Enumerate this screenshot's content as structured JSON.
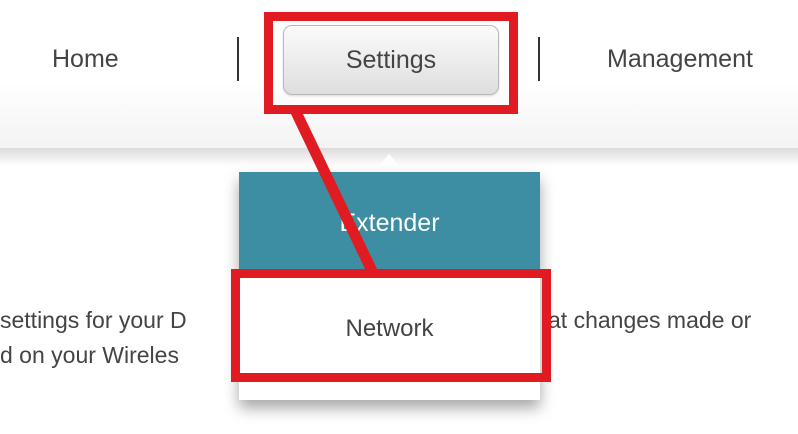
{
  "nav": {
    "home_label": "Home",
    "settings_label": "Settings",
    "management_label": "Management"
  },
  "menu": {
    "extender_label": "Extender",
    "network_label": "Network"
  },
  "content": {
    "line1_left": "settings for your D",
    "line1_right": "at changes made or",
    "line2": "d on your Wireles"
  },
  "colors": {
    "accent": "#3d8ea2",
    "annotation_red": "#e11b22",
    "text": "#444444"
  }
}
